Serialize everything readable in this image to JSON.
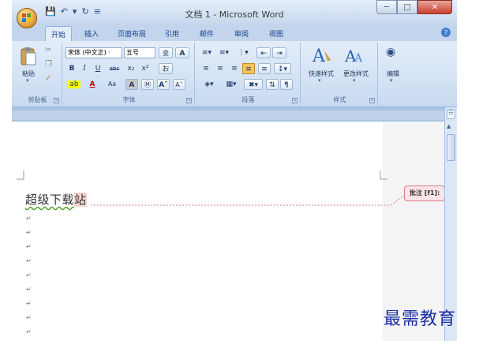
{
  "window": {
    "title": "文档 1 - Microsoft Word"
  },
  "ribbon_tabs": [
    {
      "label": "开始",
      "active": true
    },
    {
      "label": "插入",
      "active": false
    },
    {
      "label": "页面布局",
      "active": false
    },
    {
      "label": "引用",
      "active": false
    },
    {
      "label": "邮件",
      "active": false
    },
    {
      "label": "审阅",
      "active": false
    },
    {
      "label": "视图",
      "active": false
    }
  ],
  "clipboard": {
    "paste_label": "粘贴",
    "group_label": "剪贴板"
  },
  "font": {
    "font_name": "宋体 (中文正) ·",
    "font_size": "五号",
    "group_label": "字体"
  },
  "paragraph": {
    "group_label": "段落"
  },
  "styles": {
    "quick_styles_label": "快速样式",
    "change_styles_label": "更改样式",
    "group_label": "样式"
  },
  "editing": {
    "label": "编辑"
  },
  "document": {
    "text_main": "超级下载",
    "text_highlight": "站"
  },
  "comment": {
    "label": "批注 [f1]:"
  },
  "watermark": "最需教育",
  "colors": {
    "ribbon_bg": "#c8daf0",
    "accent": "#15428b",
    "comment_border": "#d57c85",
    "watermark": "#1a2fa0"
  }
}
